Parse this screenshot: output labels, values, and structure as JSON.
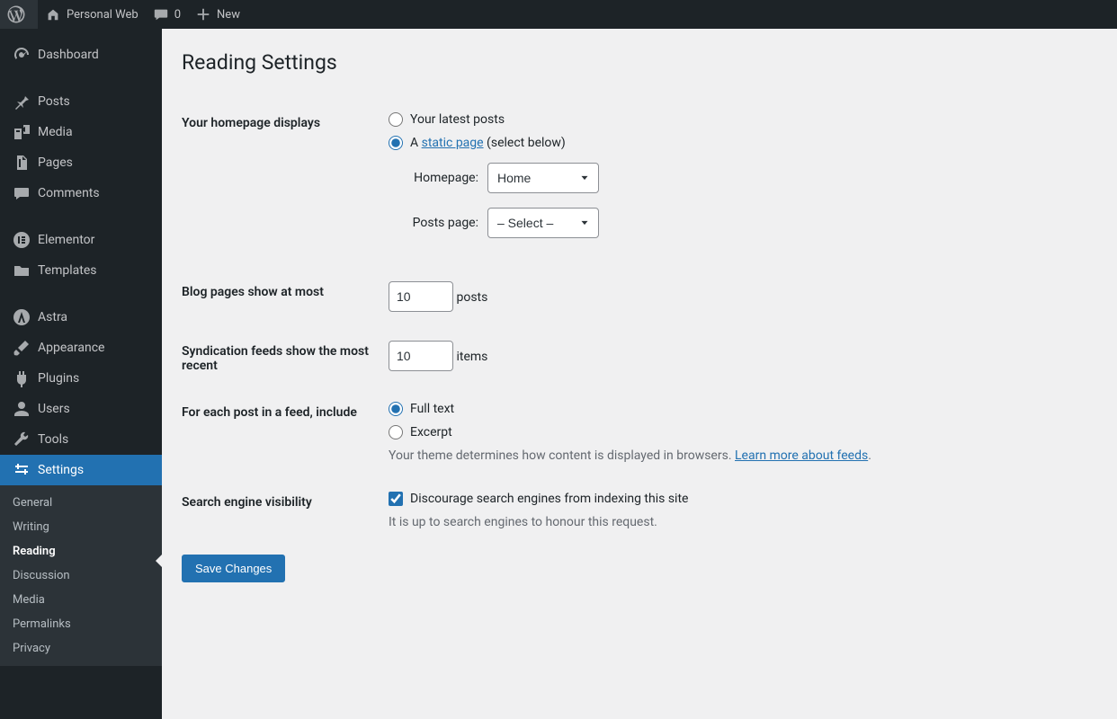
{
  "adminbar": {
    "site_name": "Personal Web",
    "comments_count": "0",
    "new_label": "New"
  },
  "sidebar": {
    "items": [
      {
        "label": "Dashboard",
        "icon": "dashboard"
      },
      {
        "label": "Posts",
        "icon": "pin"
      },
      {
        "label": "Media",
        "icon": "media"
      },
      {
        "label": "Pages",
        "icon": "pages"
      },
      {
        "label": "Comments",
        "icon": "comment"
      },
      {
        "label": "Elementor",
        "icon": "elementor"
      },
      {
        "label": "Templates",
        "icon": "folder"
      },
      {
        "label": "Astra",
        "icon": "astra"
      },
      {
        "label": "Appearance",
        "icon": "brush"
      },
      {
        "label": "Plugins",
        "icon": "plugin"
      },
      {
        "label": "Users",
        "icon": "user"
      },
      {
        "label": "Tools",
        "icon": "wrench"
      },
      {
        "label": "Settings",
        "icon": "sliders"
      }
    ],
    "settings_submenu": [
      "General",
      "Writing",
      "Reading",
      "Discussion",
      "Media",
      "Permalinks",
      "Privacy"
    ]
  },
  "page": {
    "title": "Reading Settings",
    "fields": {
      "homepage_displays": {
        "label": "Your homepage displays",
        "opt_latest": "Your latest posts",
        "opt_static_prefix": "A ",
        "opt_static_link": "static page",
        "opt_static_suffix": " (select below)",
        "homepage_label": "Homepage:",
        "homepage_value": "Home",
        "postspage_label": "Posts page:",
        "postspage_value": "– Select –"
      },
      "blog_pages": {
        "label": "Blog pages show at most",
        "value": "10",
        "unit": "posts"
      },
      "syndication": {
        "label": "Syndication feeds show the most recent",
        "value": "10",
        "unit": "items"
      },
      "feed_content": {
        "label": "For each post in a feed, include",
        "opt_full": "Full text",
        "opt_excerpt": "Excerpt",
        "desc_prefix": "Your theme determines how content is displayed in browsers. ",
        "desc_link": "Learn more about feeds"
      },
      "search_visibility": {
        "label": "Search engine visibility",
        "checkbox_label": "Discourage search engines from indexing this site",
        "desc": "It is up to search engines to honour this request."
      }
    },
    "save_button": "Save Changes"
  }
}
